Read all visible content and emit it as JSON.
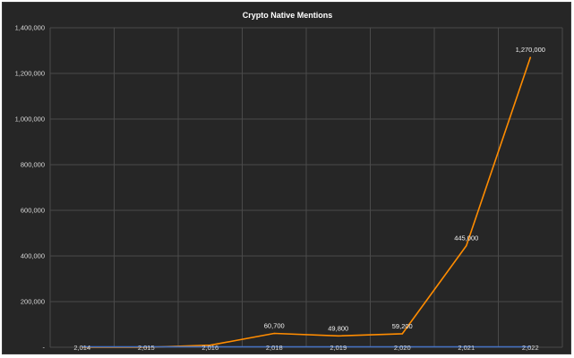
{
  "chart_data": {
    "type": "line",
    "title": "Crypto Native Mentions",
    "xlabel": "",
    "ylabel": "",
    "categories": [
      "2,014",
      "2,015",
      "2,016",
      "2,018",
      "2,019",
      "2,020",
      "2,021",
      "2,022"
    ],
    "ylim": [
      0,
      1400000
    ],
    "y_ticks": [
      0,
      200000,
      400000,
      600000,
      800000,
      1000000,
      1200000,
      1400000
    ],
    "y_tick_labels": [
      "-",
      "200,000",
      "400,000",
      "600,000",
      "800,000",
      "1,000,000",
      "1,200,000",
      "1,400,000"
    ],
    "grid": true,
    "series": [
      {
        "values": [
          0,
          0,
          9000,
          60700,
          49800,
          59200,
          445000,
          1270000
        ],
        "color": "#ff8c00",
        "data_labels": [
          "",
          "",
          "",
          "60,700",
          "49,800",
          "59,200",
          "445,000",
          "1,270,000"
        ]
      },
      {
        "values": [
          2014,
          2015,
          2016,
          2018,
          2019,
          2020,
          2021,
          2022
        ],
        "color": "#4472c4",
        "data_labels": []
      }
    ]
  }
}
